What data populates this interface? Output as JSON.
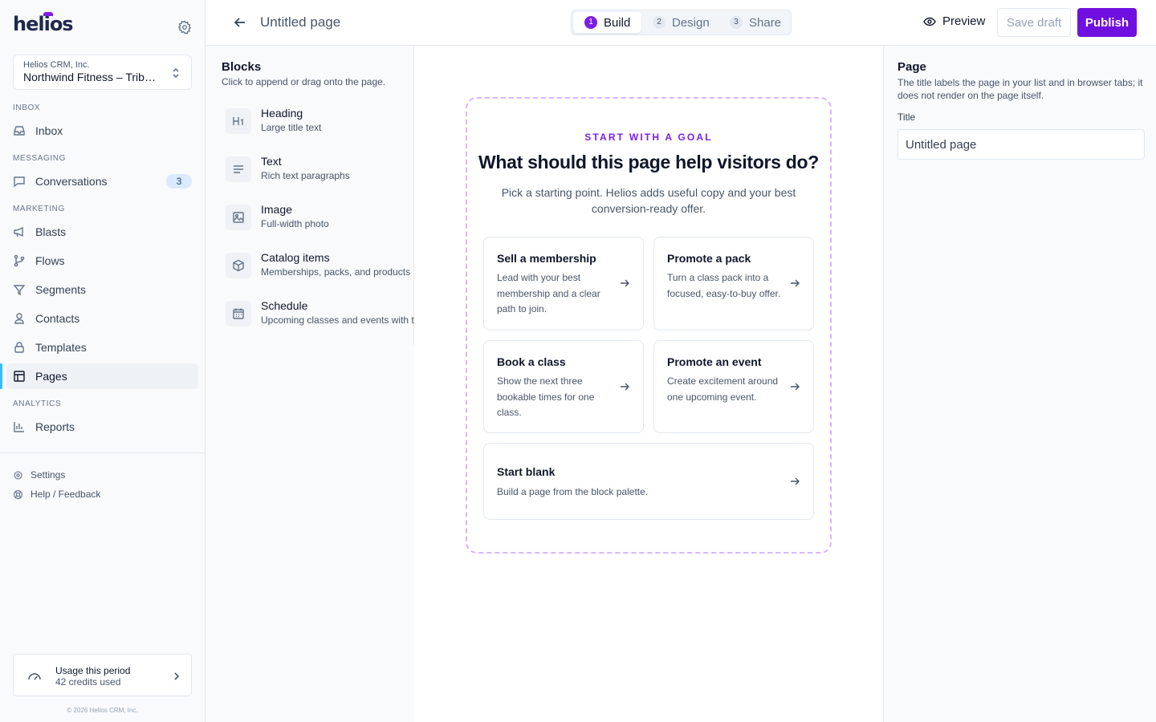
{
  "brand": {
    "name": "helios",
    "accent": "#7010e0"
  },
  "org": {
    "company": "Helios CRM, Inc.",
    "location": "Northwind Fitness – Tribeca"
  },
  "sidebar": {
    "sections": [
      {
        "label": "INBOX"
      },
      {
        "label": "MESSAGING"
      },
      {
        "label": "MARKETING"
      },
      {
        "label": "ANALYTICS"
      }
    ],
    "items": [
      {
        "label": "Inbox",
        "icon": "inbox-icon"
      },
      {
        "label": "Conversations",
        "icon": "message-icon",
        "badge": "3"
      },
      {
        "label": "Blasts",
        "icon": "megaphone-icon"
      },
      {
        "label": "Flows",
        "icon": "git-branch-icon"
      },
      {
        "label": "Segments",
        "icon": "filter-icon"
      },
      {
        "label": "Contacts",
        "icon": "user-icon"
      },
      {
        "label": "Templates",
        "icon": "lock-icon"
      },
      {
        "label": "Pages",
        "icon": "layout-icon",
        "active": true
      },
      {
        "label": "Reports",
        "icon": "bar-chart-icon"
      }
    ],
    "links": [
      {
        "label": "Settings",
        "icon": "gear-icon"
      },
      {
        "label": "Help / Feedback",
        "icon": "lifebuoy-icon"
      }
    ],
    "usage": {
      "title": "Usage this period",
      "value": "42 credits used"
    },
    "copyright": "© 2026 Helios CRM, Inc."
  },
  "topbar": {
    "title": "Untitled page",
    "steps": [
      {
        "num": "1",
        "label": "Build",
        "active": true
      },
      {
        "num": "2",
        "label": "Design"
      },
      {
        "num": "3",
        "label": "Share"
      }
    ],
    "preview": "Preview",
    "save": "Save draft",
    "publish": "Publish"
  },
  "blocks": {
    "title": "Blocks",
    "hint": "Click to append or drag onto the page.",
    "items": [
      {
        "title": "Heading",
        "desc": "Large title text",
        "icon": "heading-icon"
      },
      {
        "title": "Text",
        "desc": "Rich text paragraphs",
        "icon": "text-lines-icon"
      },
      {
        "title": "Image",
        "desc": "Full-width photo",
        "icon": "image-icon"
      },
      {
        "title": "Catalog items",
        "desc": "Memberships, packs, and products",
        "icon": "box-icon"
      },
      {
        "title": "Schedule",
        "desc": "Upcoming classes and events with times",
        "icon": "calendar-icon"
      }
    ]
  },
  "canvas": {
    "eyebrow": "START WITH A GOAL",
    "heading": "What should this page help visitors do?",
    "sub": "Pick a starting point. Helios adds useful copy and your best conversion-ready offer.",
    "cards": [
      {
        "title": "Sell a membership",
        "desc": "Lead with your best membership and a clear path to join."
      },
      {
        "title": "Promote a pack",
        "desc": "Turn a class pack into a focused, easy-to-buy offer."
      },
      {
        "title": "Book a class",
        "desc": "Show the next three bookable times for one class."
      },
      {
        "title": "Promote an event",
        "desc": "Create excitement around one upcoming event."
      },
      {
        "title": "Start blank",
        "desc": "Build a page from the block palette."
      }
    ]
  },
  "rpanel": {
    "title": "Page",
    "hint": "The title labels the page in your list and in browser tabs; it does not render on the page itself.",
    "field_label": "Title",
    "field_value": "Untitled page"
  }
}
